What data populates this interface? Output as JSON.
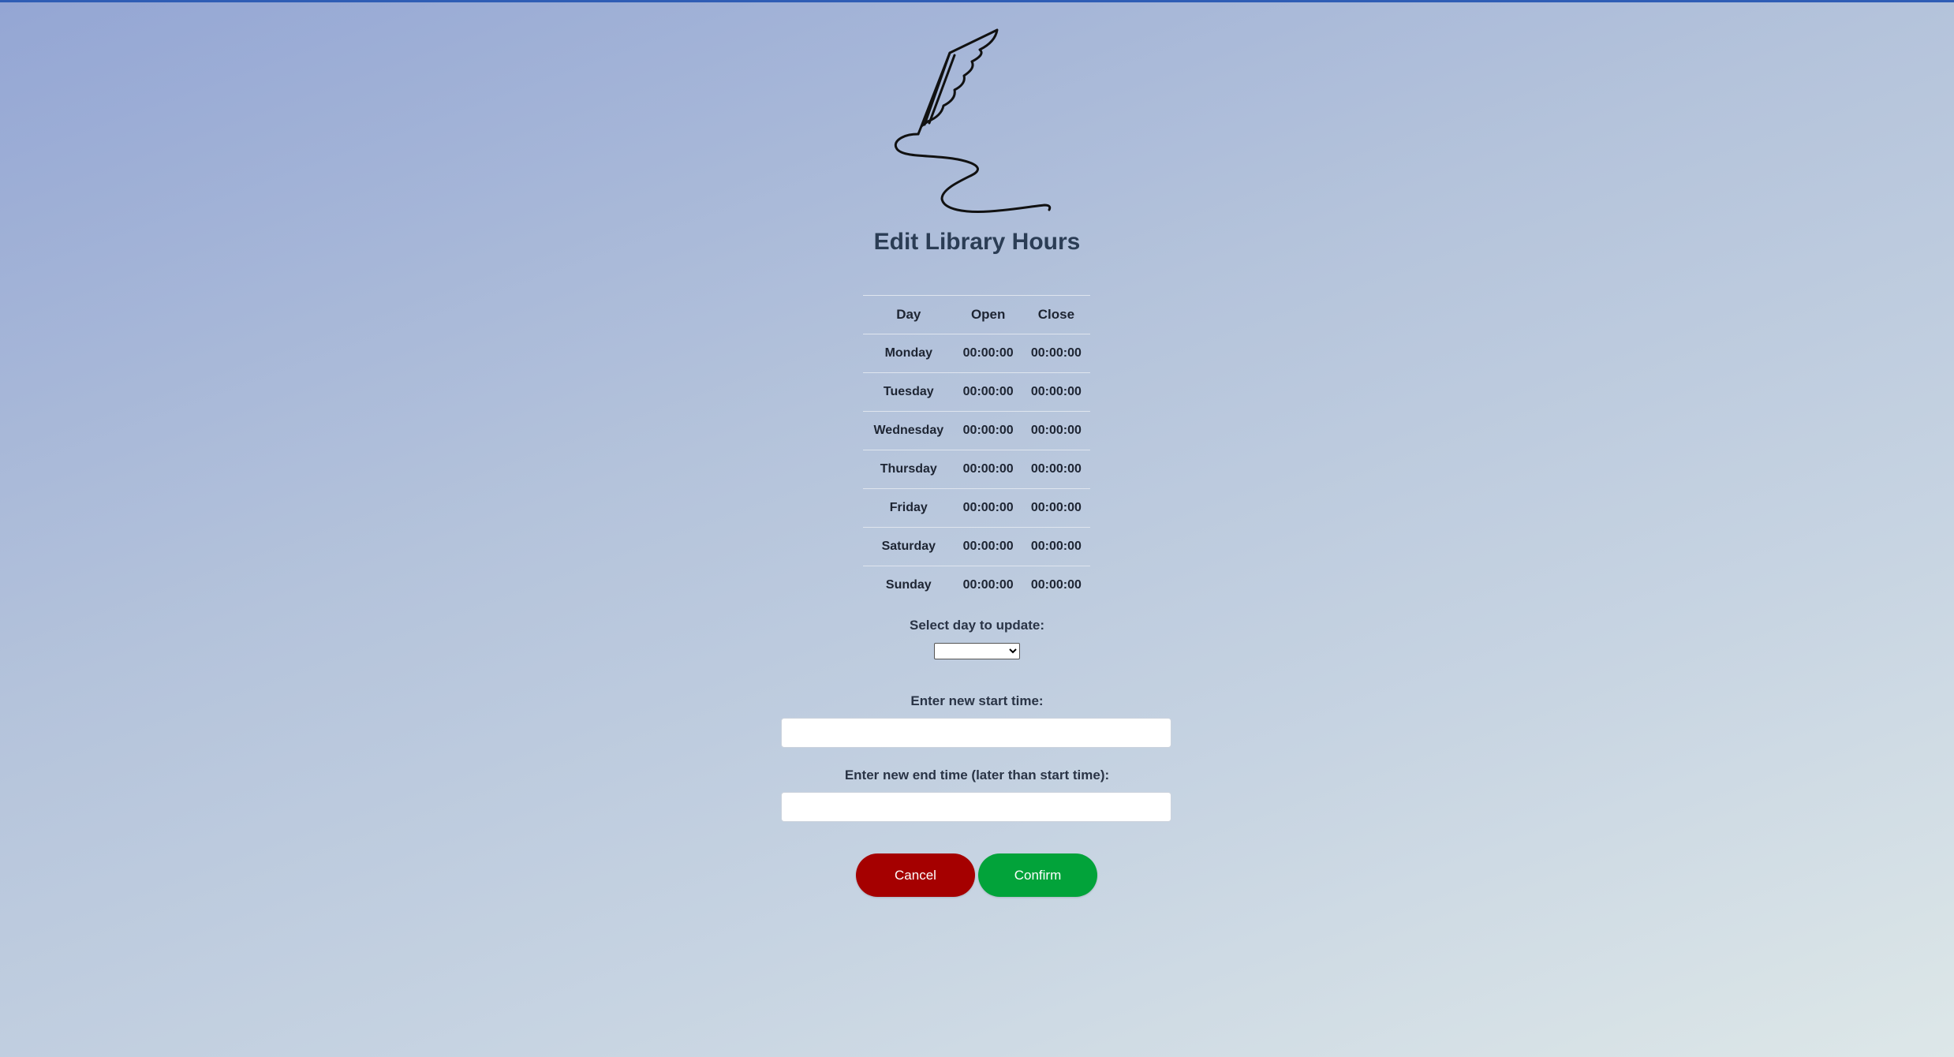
{
  "page": {
    "title": "Edit Library Hours"
  },
  "hours_table": {
    "headers": [
      "Day",
      "Open",
      "Close"
    ],
    "rows": [
      {
        "day": "Monday",
        "open": "00:00:00",
        "close": "00:00:00"
      },
      {
        "day": "Tuesday",
        "open": "00:00:00",
        "close": "00:00:00"
      },
      {
        "day": "Wednesday",
        "open": "00:00:00",
        "close": "00:00:00"
      },
      {
        "day": "Thursday",
        "open": "00:00:00",
        "close": "00:00:00"
      },
      {
        "day": "Friday",
        "open": "00:00:00",
        "close": "00:00:00"
      },
      {
        "day": "Saturday",
        "open": "00:00:00",
        "close": "00:00:00"
      },
      {
        "day": "Sunday",
        "open": "00:00:00",
        "close": "00:00:00"
      }
    ]
  },
  "form": {
    "select_day_label": "Select day to update:",
    "select_day_value": "",
    "start_time_label": "Enter new start time:",
    "start_time_value": "",
    "end_time_label": "Enter new end time (later than start time):",
    "end_time_value": ""
  },
  "buttons": {
    "cancel_label": "Cancel",
    "confirm_label": "Confirm"
  },
  "colors": {
    "cancel": "#a50000",
    "confirm": "#02a33a",
    "top_bar": "#2f5db5"
  },
  "icons": {
    "logo": "quill-pen-icon"
  }
}
